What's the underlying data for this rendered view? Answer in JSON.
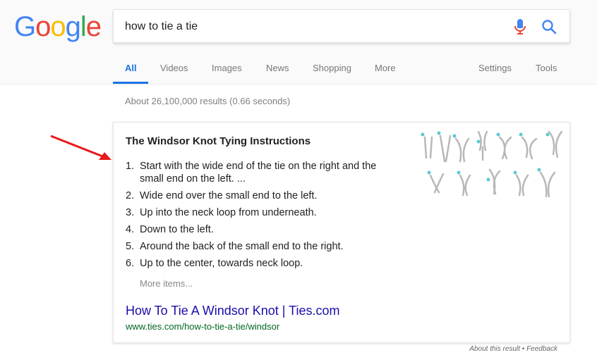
{
  "logo": {
    "letters": [
      "G",
      "o",
      "o",
      "g",
      "l",
      "e"
    ],
    "colors": [
      "#4285F4",
      "#EA4335",
      "#FBBC05",
      "#4285F4",
      "#34A853",
      "#EA4335"
    ]
  },
  "search": {
    "query": "how to tie a tie"
  },
  "tabs": [
    {
      "label": "All",
      "active": true
    },
    {
      "label": "Videos"
    },
    {
      "label": "Images"
    },
    {
      "label": "News"
    },
    {
      "label": "Shopping"
    },
    {
      "label": "More"
    },
    {
      "label": "Settings"
    },
    {
      "label": "Tools"
    }
  ],
  "result_stats": "About 26,100,000 results (0.66 seconds)",
  "featured_snippet": {
    "title": "The Windsor Knot Tying Instructions",
    "steps": [
      {
        "num": "1.",
        "text": "Start with the wide end of the tie on the right and the small end on the left. ..."
      },
      {
        "num": "2.",
        "text": "Wide end over the small end to the left."
      },
      {
        "num": "3.",
        "text": "Up into the neck loop from underneath."
      },
      {
        "num": "4.",
        "text": "Down to the left."
      },
      {
        "num": "5.",
        "text": "Around the back of the small end to the right."
      },
      {
        "num": "6.",
        "text": "Up to the center, towards neck loop."
      }
    ],
    "more_items": "More items...",
    "link_title": "How To Tie A Windsor Knot | Ties.com",
    "link_url": "www.ties.com/how-to-tie-a-tie/windsor"
  },
  "footer": {
    "about": "About this result",
    "separator": " • ",
    "feedback": "Feedback"
  },
  "icons": {
    "mic": "microphone-icon",
    "search": "search-icon",
    "arrow": "red-arrow-annotation",
    "diagram": "tie-knot-diagram"
  },
  "colors": {
    "link": "#1a0dab",
    "url": "#006621",
    "accent": "#1a73e8",
    "arrow": "#e8191b",
    "diagram_dot": "#5bc8d8"
  }
}
